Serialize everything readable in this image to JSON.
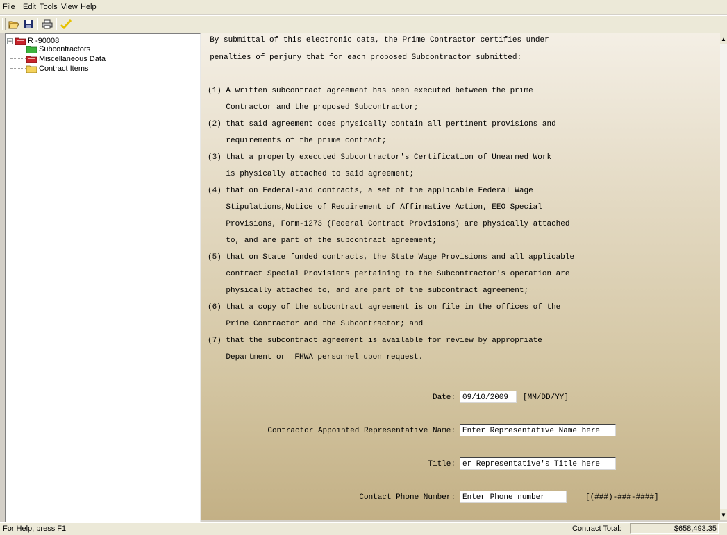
{
  "menu": [
    "File",
    "Edit",
    "Tools",
    "View",
    "Help"
  ],
  "toolbar": {
    "icons": [
      "open-folder-icon",
      "save-disk-icon",
      "print-icon",
      "checkmark-icon"
    ]
  },
  "tree": {
    "root": "R -90008",
    "expander": "−",
    "children": [
      "Subcontractors",
      "Miscellaneous Data",
      "Contract Items"
    ]
  },
  "certification": {
    "intro": [
      "  By submittal of this electronic data, the Prime Contractor certifies under",
      "  penalties of perjury that for each proposed Subcontractor submitted:"
    ],
    "items": [
      "(1) A written subcontract agreement has been executed between the prime",
      "    Contractor and the proposed Subcontractor;",
      "(2) that said agreement does physically contain all pertinent provisions and",
      "    requirements of the prime contract;",
      "(3) that a properly executed Subcontractor's Certification of Unearned Work",
      "    is physically attached to said agreement;",
      "(4) that on Federal-aid contracts, a set of the applicable Federal Wage",
      "    Stipulations,Notice of Requirement of Affirmative Action, EEO Special",
      "    Provisions, Form-1273 (Federal Contract Provisions) are physically attached",
      "    to, and are part of the subcontract agreement;",
      "(5) that on State funded contracts, the State Wage Provisions and all applicable",
      "    contract Special Provisions pertaining to the Subcontractor's operation are",
      "    physically attached to, and are part of the subcontract agreement;",
      "(6) that a copy of the subcontract agreement is on file in the offices of the",
      "    Prime Contractor and the Subcontractor; and",
      "(7) that the subcontract agreement is available for review by appropriate",
      "    Department or  FHWA personnel upon request."
    ]
  },
  "form": {
    "date_label": "Date:",
    "date_value": "09/10/2009",
    "date_hint": "[MM/DD/YY]",
    "rep_label": "Contractor Appointed Representative Name:",
    "rep_value": "Enter Representative Name here",
    "title_label": "Title:",
    "title_value": "er Representative's Title here",
    "phone_label": "Contact Phone Number:",
    "phone_value": "Enter Phone number",
    "phone_hint": "[(###)-###-####]"
  },
  "status": {
    "help": "For Help, press F1",
    "total_label": "Contract Total:",
    "total_value": "$658,493.35"
  },
  "scrollbar": {
    "up": "▲",
    "down": "▼"
  }
}
